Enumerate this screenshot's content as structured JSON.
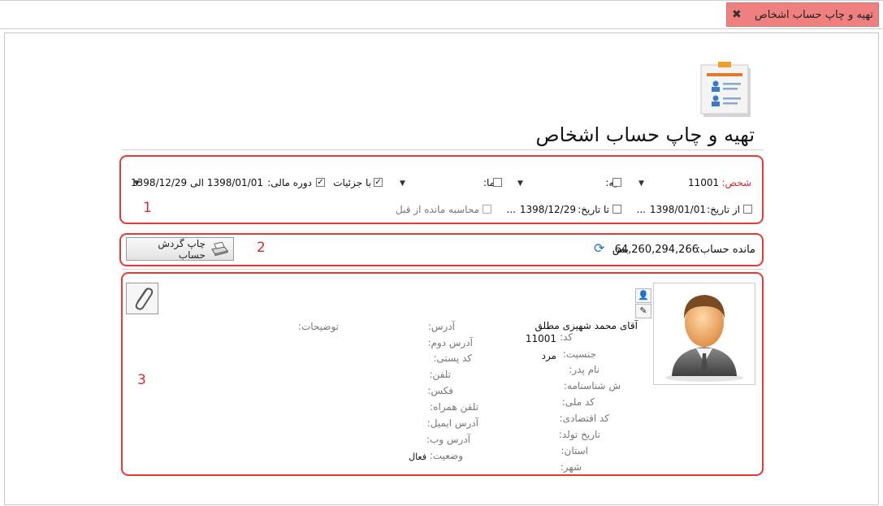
{
  "tab": {
    "title": "تهیه و چاپ حساب اشخاص",
    "close_icon": "close-icon"
  },
  "page": {
    "title": "تهیه و چاپ حساب اشخاص",
    "icon": "document-list-icon"
  },
  "filters": {
    "person_label": "شخص:",
    "person_value": "11001",
    "layer_label": "لایه:",
    "view_label": "نما:",
    "with_details_label": "با جزئیات",
    "with_details_checked": true,
    "fiscal_period_label": "دوره مالی:",
    "fiscal_period_checked": true,
    "fiscal_period_value": "1398/01/01 الی 1398/12/29",
    "from_date_label": "از تاریخ:",
    "from_date_value": "1398/01/01",
    "to_date_label": "تا تاریخ:",
    "to_date_value": "1398/12/29",
    "ellipsis": "...",
    "prev_balance_label": "محاسبه مانده از قبل"
  },
  "balance": {
    "label": "مانده حساب:",
    "value": "64,260,294,266",
    "suffix": "بس",
    "print_button": "چاپ گردش حساب",
    "refresh_icon": "refresh-icon",
    "printer_icon": "printer-icon"
  },
  "annotations": {
    "n1": "1",
    "n2": "2",
    "n3": "3"
  },
  "person": {
    "name": "آقای محمد شهیزی مطلق",
    "code_label": "کد:",
    "code_value": "11001",
    "gender_label": "جنسیت:",
    "gender_value": "مرد",
    "father_label": "نام پدر:",
    "id_no_label": "ش شناسنامه:",
    "national_code_label": "کد ملی:",
    "economic_code_label": "کد اقتصادی:",
    "birth_date_label": "تاریخ تولد:",
    "province_label": "استان:",
    "city_label": "شهر:",
    "address_label": "آدرس:",
    "address2_label": "آدرس دوم:",
    "postal_label": "کد پستی:",
    "phone_label": "تلفن:",
    "fax_label": "فکس:",
    "mobile_label": "تلفن همراه:",
    "email_label": "آدرس ایمیل:",
    "web_label": "آدرس وب:",
    "status_label": "وضعیت:",
    "status_value": "فعال",
    "notes_label": "توضیحات:",
    "avatar_icon": "person-avatar-icon",
    "user_icon": "user-icon",
    "edit_icon": "pencil-icon",
    "attach_icon": "paperclip-icon"
  },
  "colors": {
    "tab_bg": "#f08080",
    "frame_red": "#e53935",
    "label_red": "#d32f2f"
  }
}
